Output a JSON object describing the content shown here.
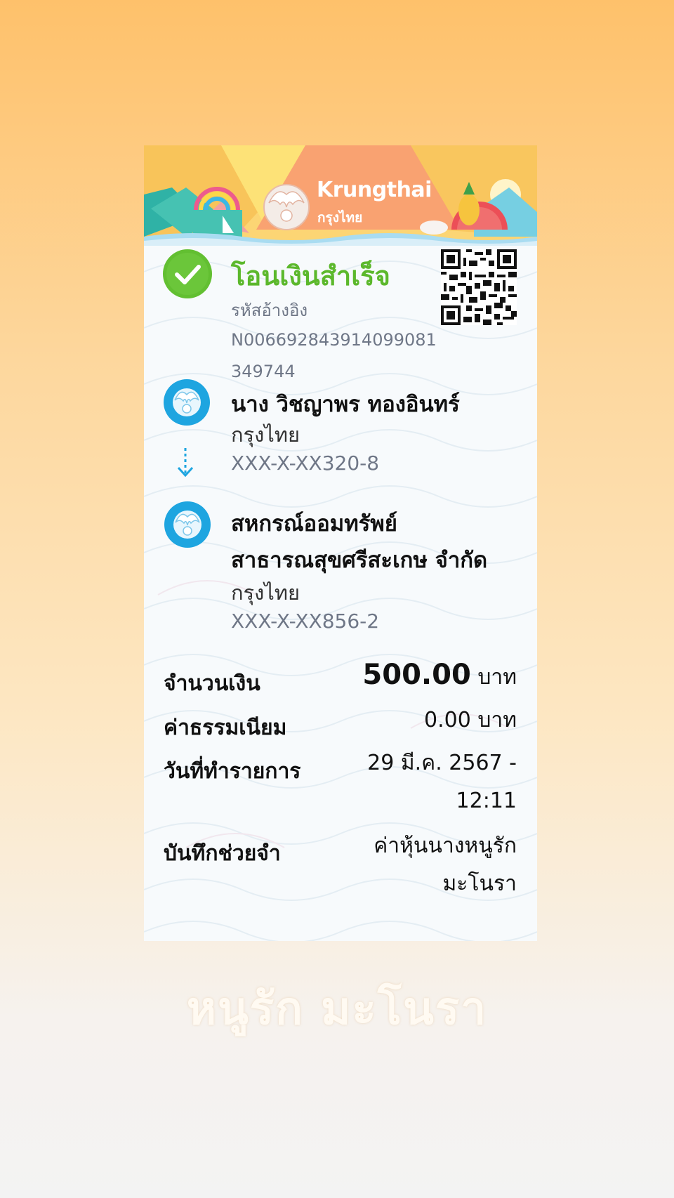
{
  "bank": {
    "logo_name": "Krungthai",
    "logo_name_thai": "กรุงไทย"
  },
  "status": {
    "title": "โอนเงินสำเร็จ",
    "ref_label": "รหัสอ้างอิง",
    "ref_number": "N006692843914099081349744",
    "success_color": "#5cb82c"
  },
  "sender": {
    "name": "นาง วิชญาพร ทองอินทร์",
    "bank": "กรุงไทย",
    "account": "XXX-X-XX320-8"
  },
  "receiver": {
    "name_line1": "สหกรณ์ออมทรัพย์",
    "name_line2": "สาธารณสุขศรีสะเกษ จำกัด",
    "bank": "กรุงไทย",
    "account": "XXX-X-XX856-2"
  },
  "details": {
    "amount_label": "จำนวนเงิน",
    "amount_value": "500.00",
    "amount_unit": "บาท",
    "fee_label": "ค่าธรรมเนียม",
    "fee_value": "0.00 บาท",
    "date_label": "วันที่ทำรายการ",
    "date_value_line1": "29 มี.ค. 2567 -",
    "date_value_line2": "12:11",
    "memo_label": "บันทึกช่วยจำ",
    "memo_value_line1": "ค่าหุ้นนางหนูรัก",
    "memo_value_line2": "มะโนรา"
  },
  "caption": "หนูรัก มะโนรา",
  "colors": {
    "brand_blue": "#1ea5e0",
    "account_gray": "#6f7787"
  }
}
